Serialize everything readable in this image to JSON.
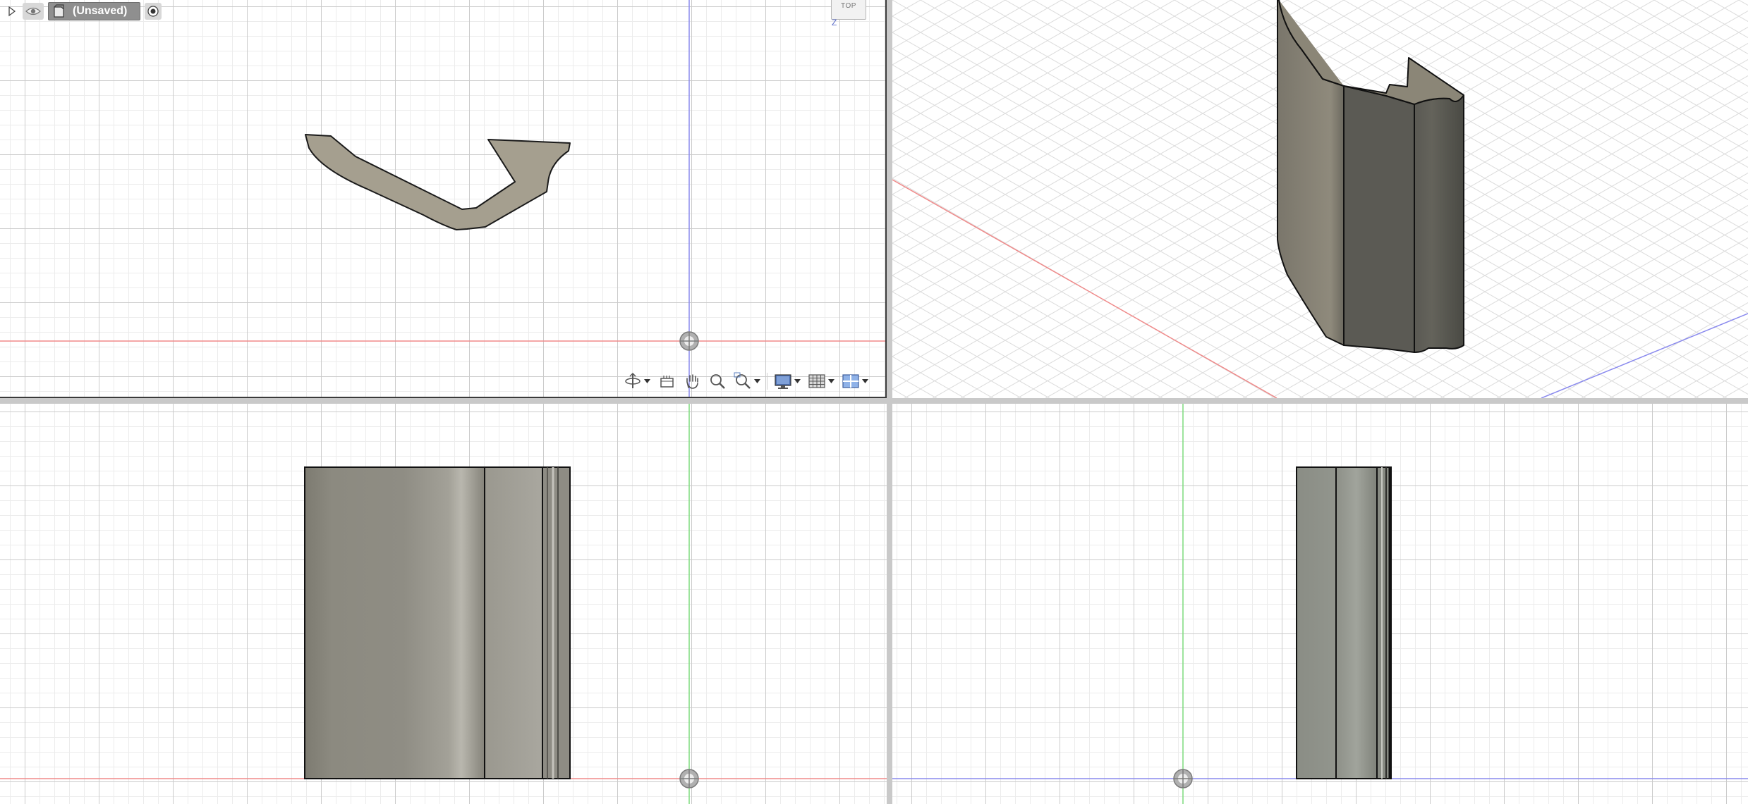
{
  "browser": {
    "document_name": "(Unsaved)",
    "icons": {
      "expand": "triangle-right-icon",
      "visibility": "eye-icon",
      "document": "component-icon",
      "active": "radio-dot-icon"
    }
  },
  "viewcube": {
    "face_label": "TOP",
    "axis_label": "Z"
  },
  "viewports": [
    {
      "name": "top",
      "object": "extruded-profile-outline"
    },
    {
      "name": "perspective",
      "object": "extruded-profile-solid"
    },
    {
      "name": "front",
      "object": "extruded-profile-front"
    },
    {
      "name": "right",
      "object": "extruded-profile-right"
    }
  ],
  "nav_toolbar": [
    {
      "icon": "orbit-icon",
      "dropdown": true
    },
    {
      "icon": "look-at-icon",
      "dropdown": false
    },
    {
      "icon": "pan-hand-icon",
      "dropdown": false
    },
    {
      "icon": "zoom-icon",
      "dropdown": false
    },
    {
      "icon": "zoom-window-icon",
      "dropdown": true
    },
    {
      "icon": "display-settings-icon",
      "dropdown": true
    },
    {
      "icon": "grid-snap-icon",
      "dropdown": true
    },
    {
      "icon": "viewports-icon",
      "dropdown": true
    }
  ],
  "colors": {
    "x_axis": "#e57373",
    "y_axis": "#7c7ce0",
    "z_axis": "#6dd66d",
    "body_fill": "#9a9482",
    "body_dark": "#5a5a54",
    "divider": "#c9c9c9"
  }
}
